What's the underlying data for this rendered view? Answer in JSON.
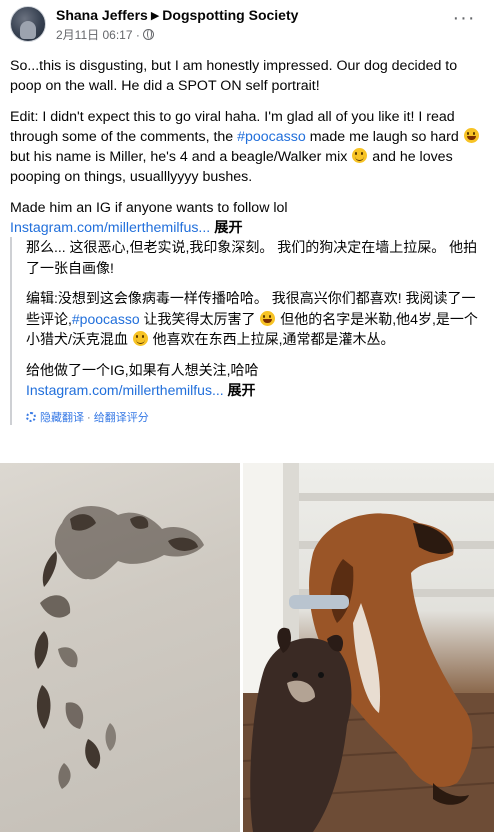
{
  "post": {
    "author": "Shana Jeffers",
    "group": "Dogspotting Society",
    "timestamp": "2月11日 06:17 ·",
    "more_label": "···",
    "paragraph1": "So...this is disgusting, but I am honestly impressed. Our dog decided to poop on the wall. He did a SPOT ON self portrait!",
    "edit_part1": "Edit: I didn't expect this to go viral haha. I'm glad all of you like it! I read through some of the comments, the ",
    "hashtag": "#poocasso",
    "edit_part2": " made me laugh so hard ",
    "edit_part3": " but his name is Miller, he's 4 and a beagle/Walker mix ",
    "edit_part4": " and he loves pooping on things, usualllyyyy bushes.",
    "ig_line": "Made him an IG if anyone wants to follow lol",
    "ig_link": "Instagram.com/millerthemilfus...",
    "expand_label": "展开",
    "emoji_laugh": "laughing-emoji",
    "emoji_smile": "smiling-emoji"
  },
  "translation": {
    "paragraph1": "那么... 这很恶心,但老实说,我印象深刻。 我们的狗决定在墙上拉屎。 他拍了一张自画像!",
    "edit_part1": "编辑:没想到这会像病毒一样传播哈哈。 我很高兴你们都喜欢! 我阅读了一些评论,",
    "hashtag": "#poocasso",
    "edit_part2": " 让我笑得太厉害了 ",
    "edit_part3": " 但他的名字是米勒,他4岁,是一个小猎犬/沃克混血 ",
    "edit_part4": " 他喜欢在东西上拉屎,通常都是灌木丛。",
    "ig_line": "给他做了一个IG,如果有人想关注,哈哈",
    "ig_link": "Instagram.com/millerthemilfus...",
    "expand_label": "展开",
    "hide_label": "隐藏翻译",
    "separator": " · ",
    "rate_label": "给翻译评分",
    "settings_icon": "gear-icon"
  },
  "photos": {
    "left": "wall-stain-photo",
    "right": "dogs-photo"
  }
}
